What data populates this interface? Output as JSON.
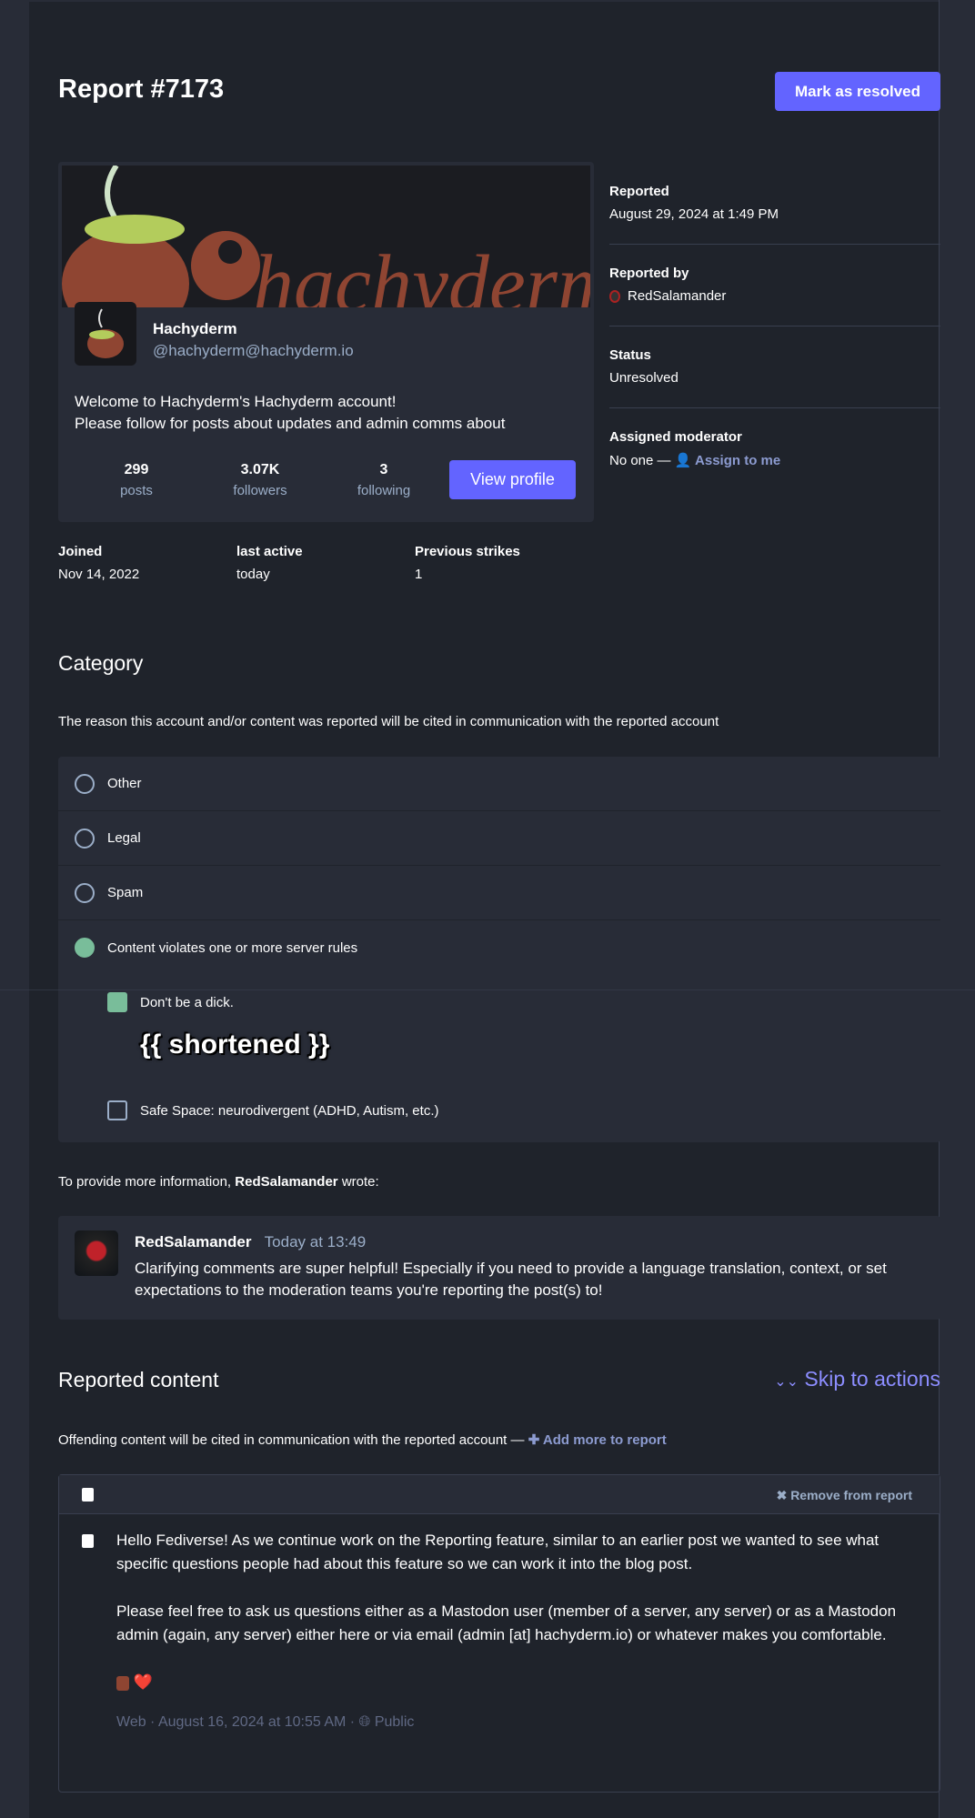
{
  "header": {
    "title": "Report #7173",
    "resolve_label": "Mark as resolved"
  },
  "profile": {
    "display_name": "Hachyderm",
    "handle": "@hachyderm@hachyderm.io",
    "banner_text": "hachyderm",
    "bio": [
      "Welcome to Hachyderm's Hachyderm account!",
      "Please follow for posts about updates and admin comms about"
    ],
    "stats": [
      {
        "value": "299",
        "label": "posts"
      },
      {
        "value": "3.07K",
        "label": "followers"
      },
      {
        "value": "3",
        "label": "following"
      }
    ],
    "view_profile_label": "View profile"
  },
  "account_meta": [
    {
      "label": "Joined",
      "value": "Nov 14, 2022"
    },
    {
      "label": "last active",
      "value": "today"
    },
    {
      "label": "Previous strikes",
      "value": "1"
    }
  ],
  "report_meta": {
    "reported_label": "Reported",
    "reported_value": "August 29, 2024 at 1:49 PM",
    "reported_by_label": "Reported by",
    "reported_by_value": "RedSalamander",
    "status_label": "Status",
    "status_value": "Unresolved",
    "moderator_label": "Assigned moderator",
    "moderator_value": "No one —",
    "assign_label": "Assign to me"
  },
  "category": {
    "heading": "Category",
    "description": "The reason this account and/or content was reported will be cited in communication with the reported account",
    "options": [
      "Other",
      "Legal",
      "Spam",
      "Content violates one or more server rules"
    ],
    "selected": 3,
    "rules": [
      {
        "label": "Don't be a dick.",
        "checked": true
      },
      {
        "label": "Safe Space: neurodivergent (ADHD, Autism, etc.)",
        "checked": false
      }
    ],
    "shortened_label": "{{ shortened }}"
  },
  "comment": {
    "intro_prefix": "To provide more information,",
    "intro_user": "RedSalamander",
    "intro_suffix": "wrote:",
    "author": "RedSalamander",
    "time": "Today at 13:49",
    "text": "Clarifying comments are super helpful! Especially if you need to provide a language translation, context, or set expectations to the moderation teams you're reporting the post(s) to!"
  },
  "reported_content": {
    "heading": "Reported content",
    "skip_label": "Skip to actions",
    "description": "Offending content will be cited in communication with the reported account —",
    "add_label": "Add more to report",
    "remove_label": "Remove from report",
    "post": {
      "paragraphs": [
        "Hello Fediverse! As we continue work on the Reporting feature, similar to an earlier post we wanted to see what specific questions people had about this feature so we can work it into the blog post.",
        "Please feel free to ask us questions either as a Mastodon user (member of a server, any server) or as a Mastodon admin (again, any server) either here or via email (admin [at] hachyderm.io) or whatever makes you comfortable."
      ],
      "emoji": "❤️",
      "meta": "Web · August 16, 2024 at 10:55 AM ·",
      "visibility": "Public"
    }
  },
  "colors": {
    "accent": "#6364ff",
    "success": "#79bd9a",
    "background": "#1f232b",
    "surface": "#282c37"
  }
}
